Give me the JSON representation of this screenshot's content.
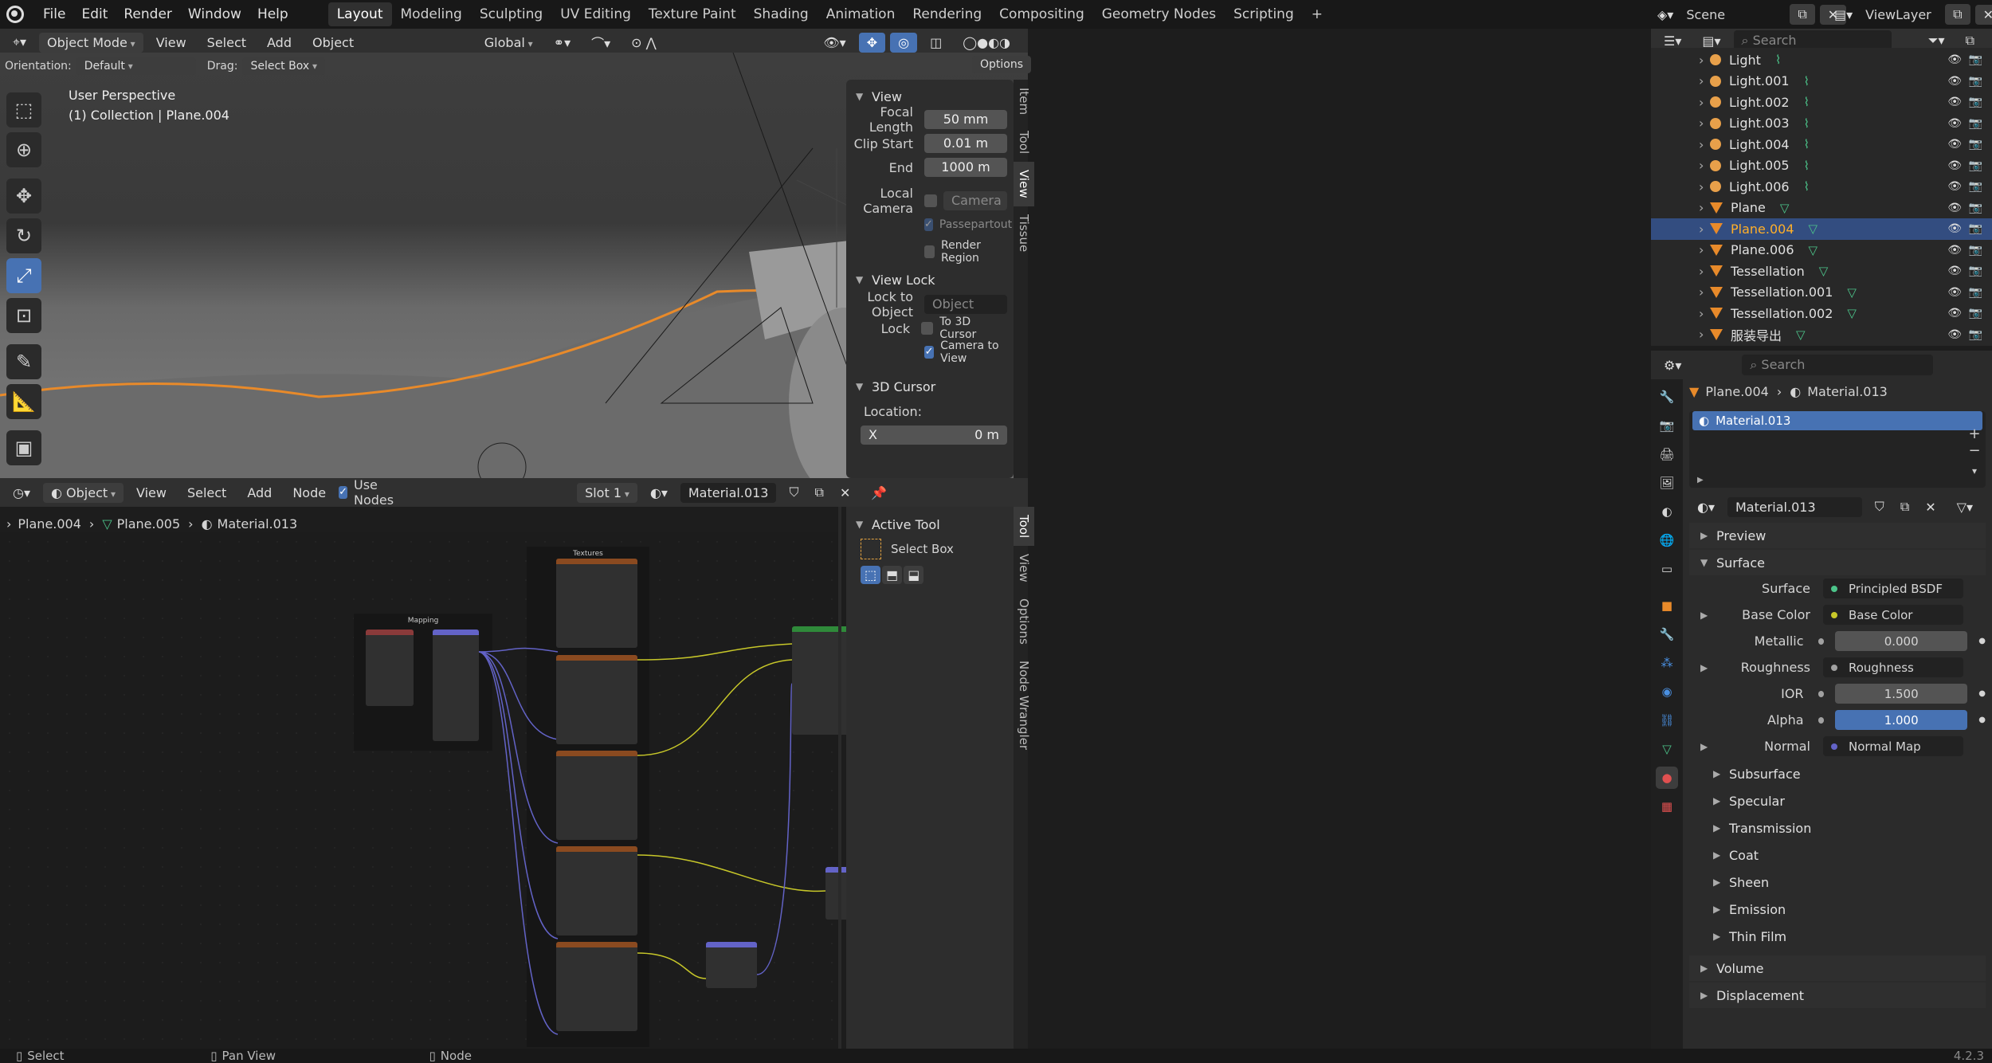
{
  "menu": [
    "File",
    "Edit",
    "Render",
    "Window",
    "Help"
  ],
  "workspaces": [
    "Layout",
    "Modeling",
    "Sculpting",
    "UV Editing",
    "Texture Paint",
    "Shading",
    "Animation",
    "Rendering",
    "Compositing",
    "Geometry Nodes",
    "Scripting"
  ],
  "scene": "Scene",
  "view_layer": "ViewLayer",
  "viewport": {
    "mode": "Object Mode",
    "menus": [
      "View",
      "Select",
      "Add",
      "Object"
    ],
    "transform_orientation": "Global",
    "orientation_label": "Orientation:",
    "orientation_value": "Default",
    "drag_label": "Drag:",
    "drag_value": "Select Box",
    "options": "Options",
    "overlay_title": "User Perspective",
    "overlay_sub": "(1) Collection | Plane.004",
    "npanel": {
      "view_header": "View",
      "focal_length_label": "Focal Length",
      "focal_length": "50 mm",
      "clip_start_label": "Clip Start",
      "clip_start": "0.01 m",
      "end_label": "End",
      "end": "1000 m",
      "local_camera_label": "Local Camera",
      "local_camera_value": "Camera",
      "passepartout": "Passepartout",
      "render_region": "Render Region",
      "view_lock_header": "View Lock",
      "lock_to_object_label": "Lock to Object",
      "lock_to_object_placeholder": "Object",
      "lock_label": "Lock",
      "to_3d_cursor": "To 3D Cursor",
      "camera_to_view": "Camera to View",
      "cursor_header": "3D Cursor",
      "location_label": "Location:",
      "x_label": "X",
      "x_value": "0 m"
    },
    "tabs": [
      "Item",
      "Tool",
      "View",
      "Tissue"
    ]
  },
  "outliner": {
    "search_placeholder": "Search",
    "items": [
      {
        "name": "Light",
        "type": "light"
      },
      {
        "name": "Light.001",
        "type": "light"
      },
      {
        "name": "Light.002",
        "type": "light"
      },
      {
        "name": "Light.003",
        "type": "light"
      },
      {
        "name": "Light.004",
        "type": "light"
      },
      {
        "name": "Light.005",
        "type": "light"
      },
      {
        "name": "Light.006",
        "type": "light"
      },
      {
        "name": "Plane",
        "type": "mesh"
      },
      {
        "name": "Plane.004",
        "type": "mesh"
      },
      {
        "name": "Plane.006",
        "type": "mesh"
      },
      {
        "name": "Tessellation",
        "type": "mesh"
      },
      {
        "name": "Tessellation.001",
        "type": "mesh"
      },
      {
        "name": "Tessellation.002",
        "type": "mesh"
      },
      {
        "name": "服装导出",
        "type": "mesh"
      }
    ]
  },
  "properties": {
    "search_placeholder": "Search",
    "breadcrumb_object": "Plane.004",
    "breadcrumb_material": "Material.013",
    "slot_material": "Material.013",
    "material_name": "Material.013",
    "sections_top": [
      "Preview",
      "Surface"
    ],
    "surface_label": "Surface",
    "surface_value": "Principled BSDF",
    "inputs": [
      {
        "label": "Base Color",
        "value": "Base Color",
        "kind": "link",
        "dot": "#c7c729"
      },
      {
        "label": "Metallic",
        "value": "0.000",
        "kind": "num",
        "dot": "#a1a1a1"
      },
      {
        "label": "Roughness",
        "value": "Roughness",
        "kind": "link",
        "dot": "#a1a1a1"
      },
      {
        "label": "IOR",
        "value": "1.500",
        "kind": "num",
        "dot": "#a1a1a1"
      },
      {
        "label": "Alpha",
        "value": "1.000",
        "kind": "blue",
        "dot": "#a1a1a1"
      },
      {
        "label": "Normal",
        "value": "Normal Map",
        "kind": "link",
        "dot": "#6363c7"
      }
    ],
    "subsections": [
      "Subsurface",
      "Specular",
      "Transmission",
      "Coat",
      "Sheen",
      "Emission",
      "Thin Film"
    ],
    "sections_bottom": [
      "Volume",
      "Displacement"
    ]
  },
  "node_editor": {
    "type": "Object",
    "menus": [
      "View",
      "Select",
      "Add",
      "Node"
    ],
    "use_nodes": "Use Nodes",
    "slot": "Slot 1",
    "material": "Material.013",
    "breadcrumb": [
      "Plane.004",
      "Plane.005",
      "Material.013"
    ],
    "frame_mapping": "Mapping",
    "frame_textures": "Textures",
    "active_tool_header": "Active Tool",
    "active_tool": "Select Box",
    "tabs": [
      "Tool",
      "View",
      "Options",
      "Node Wrangler"
    ]
  },
  "status": {
    "left": "Select",
    "mid": "Pan View",
    "right": "Node",
    "version": "4.2.3"
  },
  "colors": {
    "accent": "#4772b3",
    "selection_orange": "#e88a2a",
    "background": "#1d1d1d"
  }
}
